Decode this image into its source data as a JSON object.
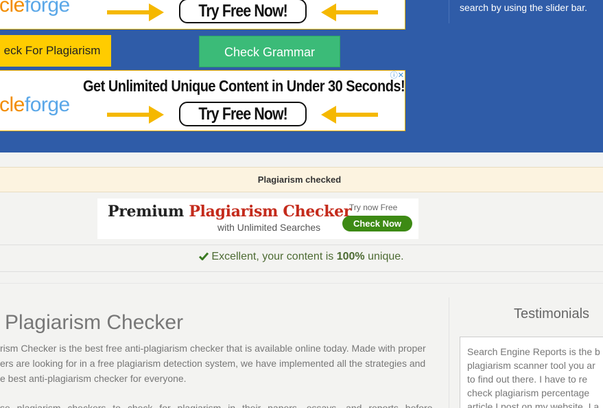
{
  "hero": {
    "side_text": [
      "search by using the slider bar."
    ],
    "ad_top": {
      "brand_left": "cle",
      "brand_right": "forge",
      "cta": "Try Free Now!"
    },
    "ad_bottom": {
      "brand_left": "cle",
      "brand_right": "forge",
      "headline": "Get Unlimited Unique Content in Under 30 Seconds!",
      "cta": "Try Free Now!",
      "ad_icons": "ⓘ✕"
    },
    "check_plagiarism_button": "eck For Plagiarism",
    "check_grammar_button": "Check Grammar"
  },
  "status_bar": {
    "label": "Plagiarism checked"
  },
  "premium_banner": {
    "title_plain": "Premium ",
    "title_accent": "Plagiarism Checker",
    "subtitle": "with Unlimited Searches",
    "try_text": "Try now Free",
    "cta": "Check Now"
  },
  "result": {
    "prefix": "Excellent, your content is ",
    "percent": "100%",
    "suffix": " unique."
  },
  "article": {
    "title": "o Plagiarism Checker",
    "paragraph1": [
      "rism Checker is the best free anti-plagiarism checker that is available online today. Made with proper",
      "ers are looking for in a free plagiarism detection system, we have implemented all the strategies and",
      "e best anti-plagiarism checker for everyone."
    ],
    "paragraph2": [
      "se plagiarism checkers to check for plagiarism in their papers, essays, and reports before"
    ]
  },
  "testimonials": {
    "title": "Testimonials",
    "text_lines": [
      "Search Engine Reports is the b",
      "plagiarism scanner tool you ar",
      "to find out there. I have to re",
      "check plagiarism percentage",
      "article I post on my website. I a"
    ]
  },
  "colors": {
    "hero_bg": "#2f5ca8",
    "plagiarism_button": "#ffcc00",
    "grammar_button": "#3bbb78",
    "accent_red": "#c42b1c",
    "success_green": "#4d6b33"
  }
}
